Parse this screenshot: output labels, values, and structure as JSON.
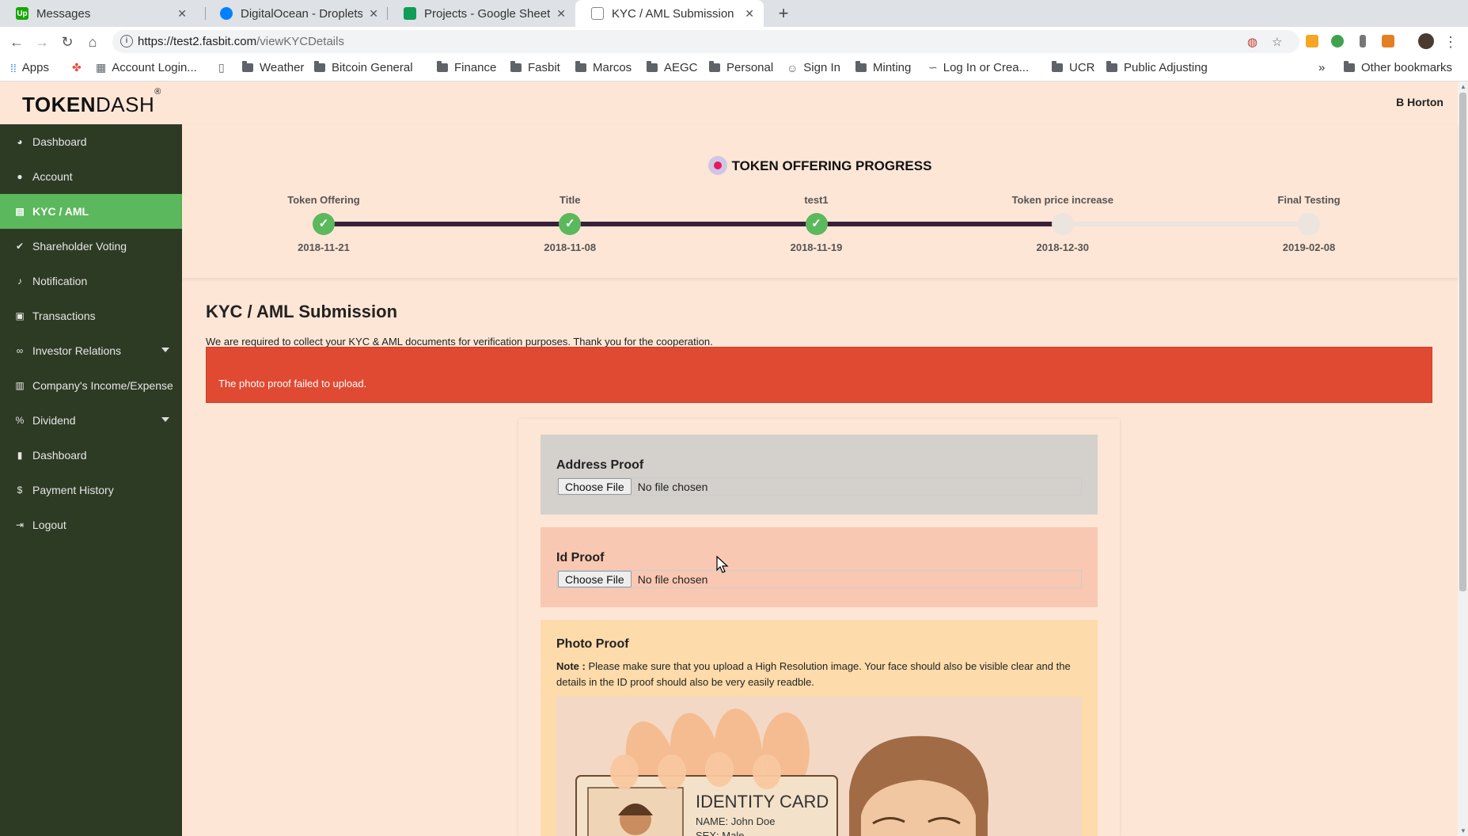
{
  "browser": {
    "tabs": [
      {
        "title": "Messages",
        "favicon_color": "#14a800",
        "favicon_text": "Up"
      },
      {
        "title": "DigitalOcean - Droplets",
        "favicon_color": "#0080ff",
        "favicon_text": ""
      },
      {
        "title": "Projects - Google Sheets",
        "favicon_color": "#0f9d58",
        "favicon_text": ""
      },
      {
        "title": "KYC / AML Submission",
        "favicon_color": "#ffffff",
        "favicon_text": ""
      }
    ],
    "close_glyph": "✕",
    "new_tab_glyph": "+",
    "url_host": "https://test2.fasbit.com",
    "url_path": "/viewKYCDetails",
    "bookmarks": [
      {
        "label": "Apps",
        "icon": "apps-icon"
      },
      {
        "label": "",
        "icon": "pinwheel-icon"
      },
      {
        "label": "Account Login...",
        "icon": "grid-icon"
      },
      {
        "label": "",
        "icon": "page-icon"
      },
      {
        "label": "Weather",
        "icon": "folder-icon"
      },
      {
        "label": "Bitcoin General",
        "icon": "folder-icon"
      },
      {
        "label": "Finance",
        "icon": "folder-icon"
      },
      {
        "label": "Fasbit",
        "icon": "folder-icon"
      },
      {
        "label": "Marcos",
        "icon": "folder-icon"
      },
      {
        "label": "AEGC",
        "icon": "folder-icon"
      },
      {
        "label": "Personal",
        "icon": "folder-icon"
      },
      {
        "label": "Sign In",
        "icon": "robot-icon"
      },
      {
        "label": "Minting",
        "icon": "folder-icon"
      },
      {
        "label": "Log In or Crea...",
        "icon": "link-icon"
      },
      {
        "label": "UCR",
        "icon": "folder-icon"
      },
      {
        "label": "Public Adjusting",
        "icon": "folder-icon"
      }
    ],
    "more_glyph": "»",
    "other_bookmarks": "Other bookmarks"
  },
  "header": {
    "logo_bold": "TOKEN",
    "logo_light": "DASH",
    "logo_mark": "®",
    "user_name": "B Horton"
  },
  "sidebar": {
    "items": [
      {
        "label": "Dashboard",
        "icon": "dashboard-icon",
        "glyph": "◕",
        "active": false,
        "caret": false
      },
      {
        "label": "Account",
        "icon": "user-icon",
        "glyph": "●",
        "active": false,
        "caret": false
      },
      {
        "label": "KYC / AML",
        "icon": "id-card-icon",
        "glyph": "▤",
        "active": true,
        "caret": false
      },
      {
        "label": "Shareholder Voting",
        "icon": "check-icon",
        "glyph": "✔",
        "active": false,
        "caret": false
      },
      {
        "label": "Notification",
        "icon": "bell-icon",
        "glyph": "♪",
        "active": false,
        "caret": false
      },
      {
        "label": "Transactions",
        "icon": "money-icon",
        "glyph": "▣",
        "active": false,
        "caret": false
      },
      {
        "label": "Investor Relations",
        "icon": "handshake-icon",
        "glyph": "∞",
        "active": false,
        "caret": true
      },
      {
        "label": "Company's Income/Expense",
        "icon": "briefcase-icon",
        "glyph": "▥",
        "active": false,
        "caret": false
      },
      {
        "label": "Dividend",
        "icon": "percent-icon",
        "glyph": "%",
        "active": false,
        "caret": true
      },
      {
        "label": "Dashboard",
        "icon": "bar-chart-icon",
        "glyph": "▮",
        "active": false,
        "caret": false
      },
      {
        "label": "Payment History",
        "icon": "dollar-icon",
        "glyph": "$",
        "active": false,
        "caret": false
      },
      {
        "label": "Logout",
        "icon": "logout-icon",
        "glyph": "⇥",
        "active": false,
        "caret": false
      }
    ]
  },
  "progress": {
    "title": "TOKEN OFFERING PROGRESS",
    "colors": {
      "done": "#5cb85c",
      "track_done": "#3a1f3a",
      "track_todo": "#ece4de"
    },
    "steps": [
      {
        "label": "Token Offering",
        "date": "2018-11-21",
        "done": true
      },
      {
        "label": "Title",
        "date": "2018-11-08",
        "done": true
      },
      {
        "label": "test1",
        "date": "2018-11-19",
        "done": true
      },
      {
        "label": "Token price increase",
        "date": "2018-12-30",
        "done": false
      },
      {
        "label": "Final Testing",
        "date": "2019-02-08",
        "done": false
      }
    ]
  },
  "main": {
    "title": "KYC / AML Submission",
    "description": "We are required to collect your KYC & AML documents for verification purposes. Thank you for the cooperation.",
    "alert": "The photo proof failed to upload.",
    "alert_color": "#e04a32"
  },
  "form": {
    "address": {
      "title": "Address Proof",
      "button": "Choose File",
      "status": "No file chosen",
      "bg": "#d4d1cc"
    },
    "id": {
      "title": "Id Proof",
      "button": "Choose File",
      "status": "No file chosen",
      "bg": "#f9c8b2"
    },
    "photo": {
      "title": "Photo Proof",
      "note_label": "Note :",
      "note_text": "Please make sure that you upload a High Resolution image. Your face should also be visible clear and the details in the ID proof should also be very easily readble.",
      "bg": "#fddbaa",
      "card_title": "IDENTITY CARD",
      "card_name": "NAME: John Doe",
      "card_sex": "SEX: Male"
    }
  }
}
